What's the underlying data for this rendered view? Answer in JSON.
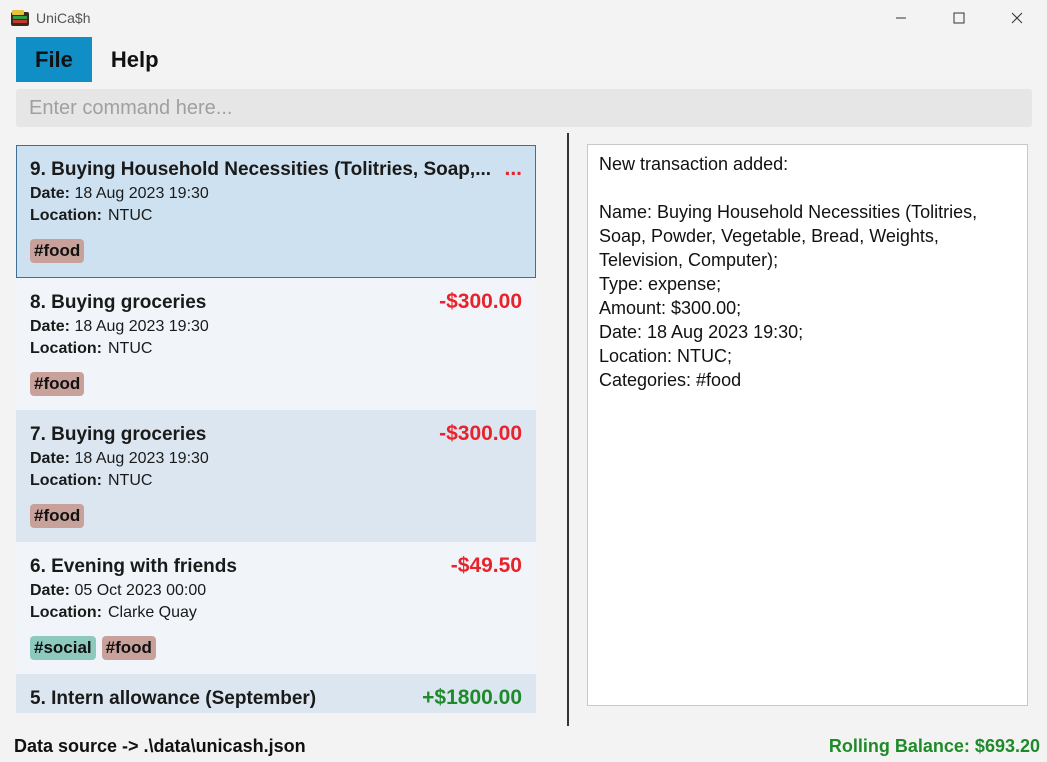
{
  "window": {
    "title": "UniCa$h",
    "icon": "wallet-icon"
  },
  "menu": {
    "file": "File",
    "help": "Help"
  },
  "command": {
    "placeholder": "Enter command here...",
    "value": ""
  },
  "transactions": [
    {
      "title": "9. Buying Household Necessities (Tolitries, Soap,...",
      "amount": "...",
      "date_label": "Date:",
      "date": "18 Aug 2023 19:30",
      "location_label": "Location:",
      "location": "NTUC",
      "tags": [
        "#food"
      ],
      "selected": true
    },
    {
      "title": "8. Buying groceries",
      "amount": "-$300.00",
      "date_label": "Date:",
      "date": "18 Aug 2023 19:30",
      "location_label": "Location:",
      "location": "NTUC",
      "tags": [
        "#food"
      ]
    },
    {
      "title": "7. Buying groceries",
      "amount": "-$300.00",
      "date_label": "Date:",
      "date": "18 Aug 2023 19:30",
      "location_label": "Location:",
      "location": "NTUC",
      "tags": [
        "#food"
      ]
    },
    {
      "title": "6. Evening with friends",
      "amount": "-$49.50",
      "date_label": "Date:",
      "date": "05 Oct 2023 00:00",
      "location_label": "Location:",
      "location": "Clarke Quay",
      "tags": [
        "#social",
        "#food"
      ]
    },
    {
      "title": "5. Intern allowance (September)",
      "amount": "+$1800.00"
    }
  ],
  "result": {
    "text": "New transaction added:\n\nName: Buying Household Necessities (Tolitries, Soap, Powder, Vegetable, Bread, Weights, Television, Computer);\nType: expense;\nAmount: $300.00;\nDate: 18 Aug 2023 19:30;\nLocation: NTUC;\nCategories: #food"
  },
  "status": {
    "source": "Data source -> .\\data\\unicash.json",
    "balance": "Rolling Balance: $693.20"
  },
  "colors": {
    "accent": "#0f8fc6",
    "expense": "#e8232b",
    "income": "#1f8a2a",
    "tag_food": "#c9a19b",
    "tag_social": "#8ec9bd"
  }
}
